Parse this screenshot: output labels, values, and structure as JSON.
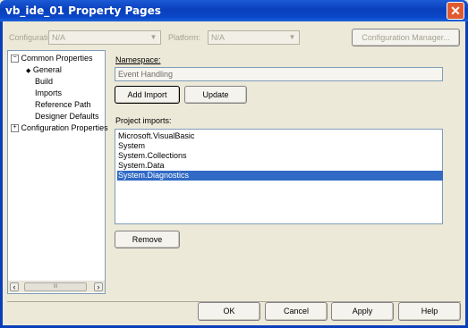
{
  "window": {
    "title": "vb_ide_01 Property Pages",
    "close_glyph": "✕"
  },
  "config_bar": {
    "configuration_label": "Configuration:",
    "configuration_value": "N/A",
    "platform_label": "Platform:",
    "platform_value": "N/A",
    "manager_button": "Configuration Manager..."
  },
  "tree": {
    "items": [
      {
        "label": "Common Properties",
        "expander": "−"
      },
      {
        "label": "General",
        "marker": "◆"
      },
      {
        "label": "Build"
      },
      {
        "label": "Imports"
      },
      {
        "label": "Reference Path"
      },
      {
        "label": "Designer Defaults"
      },
      {
        "label": "Configuration Properties",
        "expander": "+"
      }
    ],
    "scroll_left": "‹",
    "scroll_right": "›",
    "scroll_thumb": "III"
  },
  "main": {
    "namespace_label": "Namespace:",
    "namespace_value": "Event Handling",
    "add_import_button": "Add Import",
    "update_button": "Update",
    "project_imports_label": "Project imports:",
    "imports": [
      "Microsoft.VisualBasic",
      "System",
      "System.Collections",
      "System.Data",
      "System.Diagnostics"
    ],
    "selected_import": "System.Diagnostics",
    "remove_button": "Remove"
  },
  "footer": {
    "ok_button": "OK",
    "cancel_button": "Cancel",
    "apply_button": "Apply",
    "help_button": "Help"
  },
  "colors": {
    "titlebar": "#0a3fbb",
    "selection": "#316ac5",
    "dialog_bg": "#ece9d8"
  }
}
